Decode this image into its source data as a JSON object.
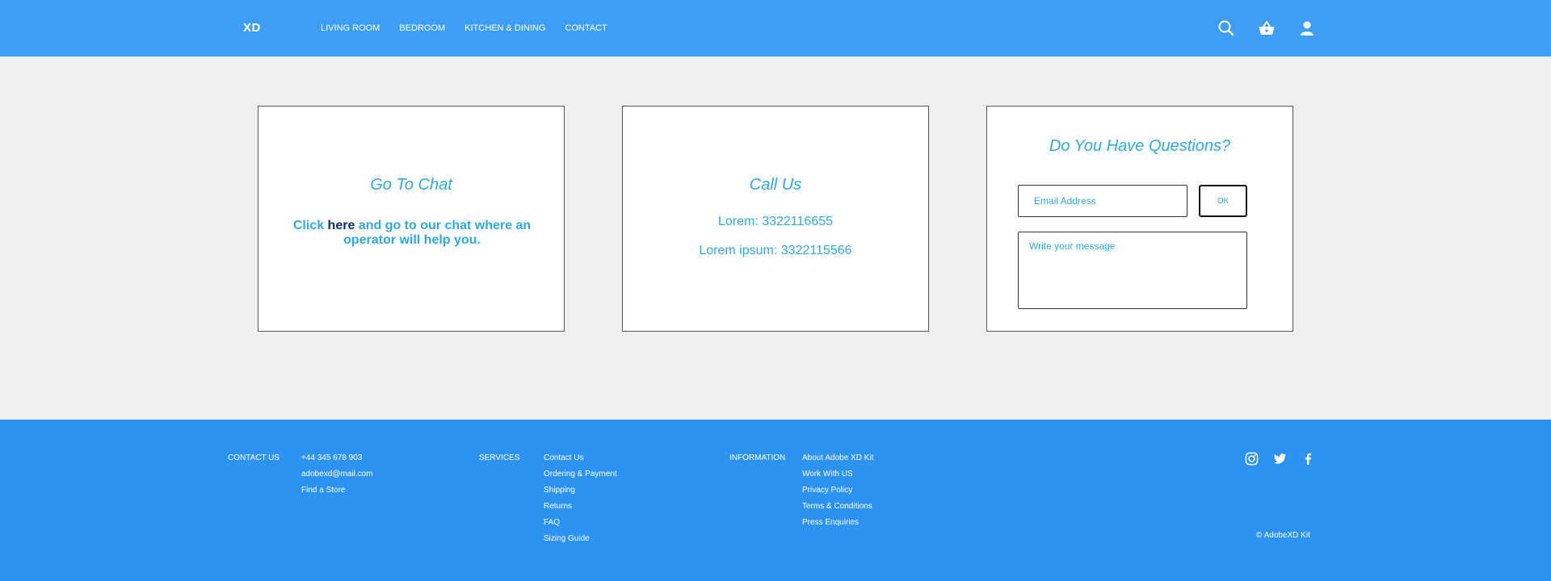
{
  "header": {
    "logo": "XD",
    "nav": [
      "LIVING ROOM",
      "BEDROOM",
      "KITCHEN & DINING",
      "CONTACT"
    ],
    "icons": [
      "search-icon",
      "basket-icon",
      "user-icon"
    ]
  },
  "cards": {
    "chat": {
      "title": "Go To Chat",
      "text_before": "Click ",
      "link": "here",
      "text_after": " and go to our chat where an operator will help you."
    },
    "call": {
      "title": "Call Us",
      "phone1": "Lorem: 3322116655",
      "phone2": "Lorem ipsum: 3322115566"
    },
    "questions": {
      "title": "Do You Have Questions?",
      "email_placeholder": "Email Address",
      "ok_label": "OK",
      "message_placeholder": "Write your message"
    }
  },
  "footer": {
    "contact": {
      "heading": "CONTACT US",
      "items": [
        "+44 345 678 903",
        "adobexd@mail.com",
        "Find a Store"
      ]
    },
    "services": {
      "heading": "SERVICES",
      "items": [
        "Contact Us",
        "Ordering & Payment",
        "Shipping",
        "Returns",
        "FAQ",
        "Sizing Guide"
      ]
    },
    "information": {
      "heading": "INFORMATION",
      "items": [
        "About Adobe XD Kit",
        "Work With US",
        "Privacy Policy",
        "Terms & Conditions",
        "Press Enquiries"
      ]
    },
    "social": [
      "instagram-icon",
      "twitter-icon",
      "facebook-icon"
    ],
    "copyright": "© AdobeXD Kit"
  },
  "colors": {
    "header_bg": "#3d9ef5",
    "footer_bg": "#2c93f1",
    "accent_text": "#2fa9df",
    "link_text": "#0b2f66",
    "page_bg": "#efefef"
  }
}
